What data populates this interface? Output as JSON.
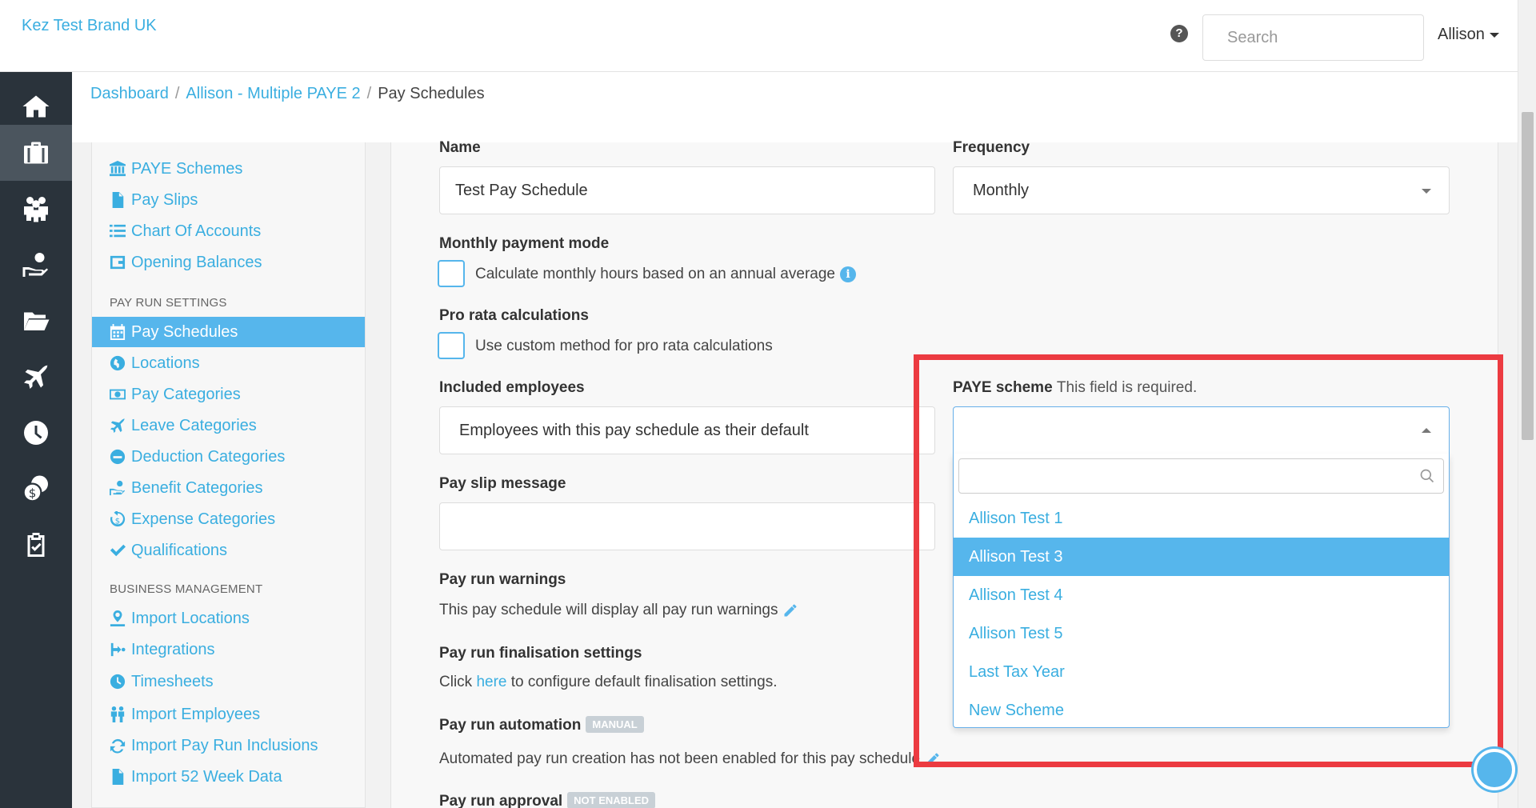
{
  "header": {
    "brand": "Kez Test Brand UK",
    "help_icon_glyph": "?",
    "search_placeholder": "Search",
    "user_name": "Allison"
  },
  "breadcrumb": {
    "items": [
      "Dashboard",
      "Allison - Multiple PAYE 2"
    ],
    "current": "Pay Schedules"
  },
  "rail": {
    "icons": [
      "home-icon",
      "briefcase-icon",
      "people-icon",
      "hand-coin-icon",
      "folder-icon",
      "plane-icon",
      "clock-icon",
      "coins-icon",
      "clipboard-check-icon"
    ],
    "active_index": 1
  },
  "left_menu": {
    "group1": [
      "PAYE Schemes",
      "Pay Slips",
      "Chart Of Accounts",
      "Opening Balances"
    ],
    "heading_pay_run": "PAY RUN SETTINGS",
    "pay_run": [
      "Pay Schedules",
      "Locations",
      "Pay Categories",
      "Leave Categories",
      "Deduction Categories",
      "Benefit Categories",
      "Expense Categories",
      "Qualifications"
    ],
    "heading_business": "BUSINESS MANAGEMENT",
    "business": [
      "Import Locations",
      "Integrations",
      "Timesheets",
      "Import Employees",
      "Import Pay Run Inclusions",
      "Import 52 Week Data"
    ],
    "active": "Pay Schedules"
  },
  "form": {
    "name_label": "Name",
    "name_value": "Test Pay Schedule",
    "frequency_label": "Frequency",
    "frequency_value": "Monthly",
    "monthly_mode_label": "Monthly payment mode",
    "monthly_mode_checkbox": "Calculate monthly hours based on an annual average",
    "monthly_mode_info_glyph": "i",
    "pro_rata_label": "Pro rata calculations",
    "pro_rata_checkbox": "Use custom method for pro rata calculations",
    "included_label": "Included employees",
    "included_value": "Employees with this pay schedule as their default",
    "payslip_msg_label": "Pay slip message",
    "payslip_msg_value": "",
    "warnings_label": "Pay run warnings",
    "warnings_text": "This pay schedule will display all pay run warnings",
    "finalisation_label": "Pay run finalisation settings",
    "finalisation_pre": "Click",
    "finalisation_link": "here",
    "finalisation_post": "to configure default finalisation settings.",
    "automation_label": "Pay run automation",
    "automation_badge": "MANUAL",
    "automation_text": "Automated pay run creation has not been enabled for this pay schedule",
    "approval_label": "Pay run approval",
    "approval_badge": "NOT ENABLED",
    "paye_label": "PAYE scheme",
    "paye_required": "This field is required."
  },
  "dropdown": {
    "search_value": "",
    "options": [
      "Allison Test 1",
      "Allison Test 3",
      "Allison Test 4",
      "Allison Test 5",
      "Last Tax Year",
      "New Scheme"
    ],
    "highlighted_index": 1
  },
  "colors": {
    "accent": "#3aaee0",
    "active_bg": "#56b6ec",
    "rail_bg": "#2a333b",
    "highlight_border": "#ec3b41"
  }
}
